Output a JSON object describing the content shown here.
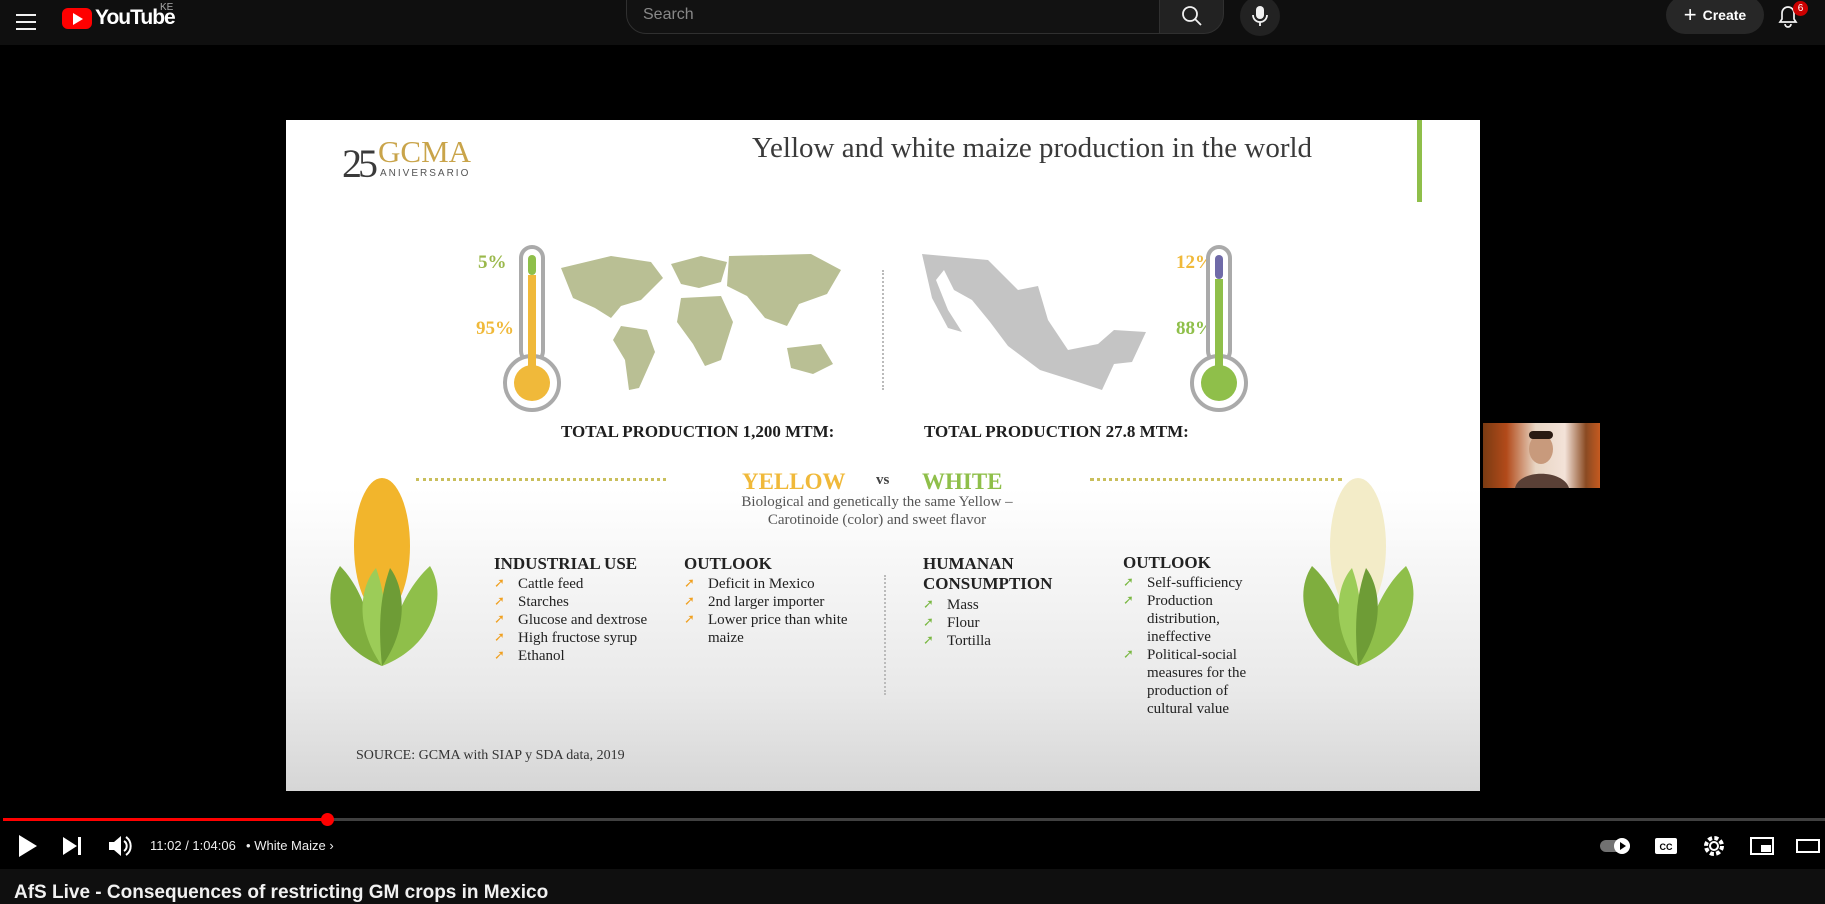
{
  "header": {
    "logo_text": "YouTube",
    "country_code": "KE",
    "search_placeholder": "Search",
    "create_label": "Create",
    "notification_count": "6"
  },
  "slide": {
    "org_number": "25",
    "org_name": "GCMA",
    "org_subtitle": "ANIVERSARIO",
    "title": "Yellow and white maize production in the world",
    "world": {
      "pct_small": "5%",
      "pct_large": "95%",
      "total": "TOTAL PRODUCTION 1,200 MTM:"
    },
    "mexico": {
      "pct_small": "12%",
      "pct_large": "88%",
      "total": "TOTAL PRODUCTION 27.8 MTM:"
    },
    "yellow_label": "YELLOW",
    "vs_label": "vs",
    "white_label": "WHITE",
    "bio_note": "Biological and genetically the same Yellow – Carotinoide (color) and sweet flavor",
    "industrial": {
      "heading": "INDUSTRIAL USE",
      "items": [
        "Cattle feed",
        "Starches",
        "Glucose and dextrose",
        "High fructose syrup",
        "Ethanol"
      ]
    },
    "outlook_yellow": {
      "heading": "OUTLOOK",
      "items": [
        "Deficit in Mexico",
        "2nd larger importer",
        "Lower price than white maize"
      ]
    },
    "human": {
      "heading": "HUMANAN CONSUMPTION",
      "items": [
        "Mass",
        "Flour",
        "Tortilla"
      ]
    },
    "outlook_white": {
      "heading": "OUTLOOK",
      "items": [
        "Self-sufficiency",
        "Production distribution, ineffective",
        "Political-social measures for the production of cultural value"
      ]
    },
    "source": "SOURCE: GCMA with SIAP y SDA data, 2019"
  },
  "player": {
    "current_time": "11:02",
    "duration": "1:04:06",
    "separator": "•",
    "chapter": "White Maize",
    "progress": 0.178
  },
  "video": {
    "title": "AfS Live - Consequences of restricting GM crops in Mexico"
  },
  "colors": {
    "brand_red": "#ff0000",
    "maize_yellow": "#f0b93a",
    "maize_green": "#8fbf4a"
  }
}
